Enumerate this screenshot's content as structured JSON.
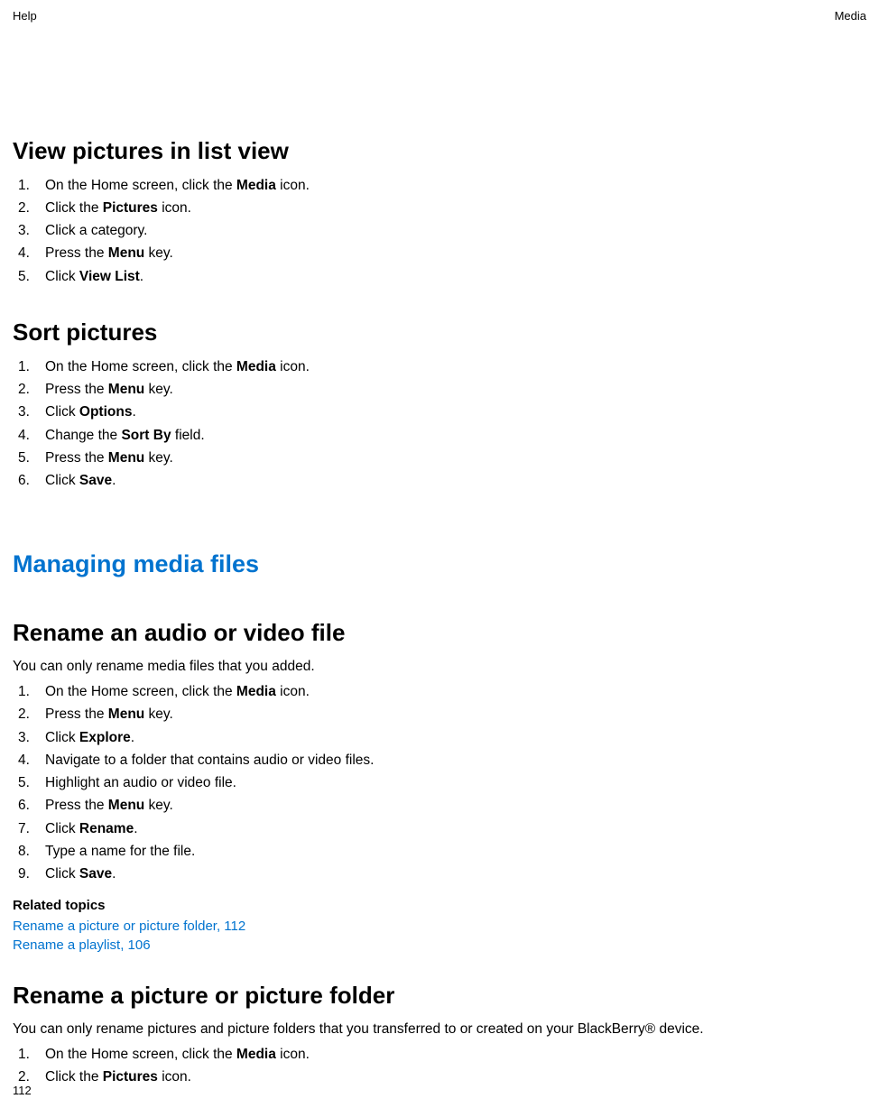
{
  "header": {
    "left": "Help",
    "right": "Media"
  },
  "sections": {
    "viewPictures": {
      "heading": "View pictures in list view",
      "steps": [
        {
          "n": "1.",
          "prefix": "On the Home screen, click the ",
          "bold": "Media",
          "suffix": " icon."
        },
        {
          "n": "2.",
          "prefix": "Click the ",
          "bold": "Pictures",
          "suffix": " icon."
        },
        {
          "n": "3.",
          "prefix": "Click a category.",
          "bold": "",
          "suffix": ""
        },
        {
          "n": "4.",
          "prefix": "Press the ",
          "bold": "Menu",
          "suffix": " key."
        },
        {
          "n": "5.",
          "prefix": "Click ",
          "bold": "View List",
          "suffix": "."
        }
      ]
    },
    "sortPictures": {
      "heading": "Sort pictures",
      "steps": [
        {
          "n": "1.",
          "prefix": "On the Home screen, click the ",
          "bold": "Media",
          "suffix": " icon."
        },
        {
          "n": "2.",
          "prefix": "Press the ",
          "bold": "Menu",
          "suffix": " key."
        },
        {
          "n": "3.",
          "prefix": "Click ",
          "bold": "Options",
          "suffix": "."
        },
        {
          "n": "4.",
          "prefix": "Change the ",
          "bold": "Sort By",
          "suffix": " field."
        },
        {
          "n": "5.",
          "prefix": "Press the ",
          "bold": "Menu",
          "suffix": " key."
        },
        {
          "n": "6.",
          "prefix": "Click ",
          "bold": "Save",
          "suffix": "."
        }
      ]
    },
    "managing": {
      "heading": "Managing media files"
    },
    "renameAudioVideo": {
      "heading": "Rename an audio or video file",
      "note": "You can only rename media files that you added.",
      "steps": [
        {
          "n": "1.",
          "prefix": "On the Home screen, click the ",
          "bold": "Media",
          "suffix": " icon."
        },
        {
          "n": "2.",
          "prefix": "Press the ",
          "bold": "Menu",
          "suffix": " key."
        },
        {
          "n": "3.",
          "prefix": "Click ",
          "bold": "Explore",
          "suffix": "."
        },
        {
          "n": "4.",
          "prefix": "Navigate to a folder that contains audio or video files.",
          "bold": "",
          "suffix": ""
        },
        {
          "n": "5.",
          "prefix": "Highlight an audio or video file.",
          "bold": "",
          "suffix": ""
        },
        {
          "n": "6.",
          "prefix": "Press the ",
          "bold": "Menu",
          "suffix": " key."
        },
        {
          "n": "7.",
          "prefix": "Click ",
          "bold": "Rename",
          "suffix": "."
        },
        {
          "n": "8.",
          "prefix": "Type a name for the file.",
          "bold": "",
          "suffix": ""
        },
        {
          "n": "9.",
          "prefix": "Click ",
          "bold": "Save",
          "suffix": "."
        }
      ],
      "relatedHeading": "Related topics",
      "relatedLinks": [
        "Rename a picture or picture folder, 112",
        "Rename a playlist, 106"
      ]
    },
    "renamePicture": {
      "heading": "Rename a picture or picture folder",
      "note": "You can only rename pictures and picture folders that you transferred to or created on your BlackBerry® device.",
      "steps": [
        {
          "n": "1.",
          "prefix": "On the Home screen, click the ",
          "bold": "Media",
          "suffix": " icon."
        },
        {
          "n": "2.",
          "prefix": "Click the ",
          "bold": "Pictures",
          "suffix": " icon."
        }
      ]
    }
  },
  "pageNumber": "112"
}
